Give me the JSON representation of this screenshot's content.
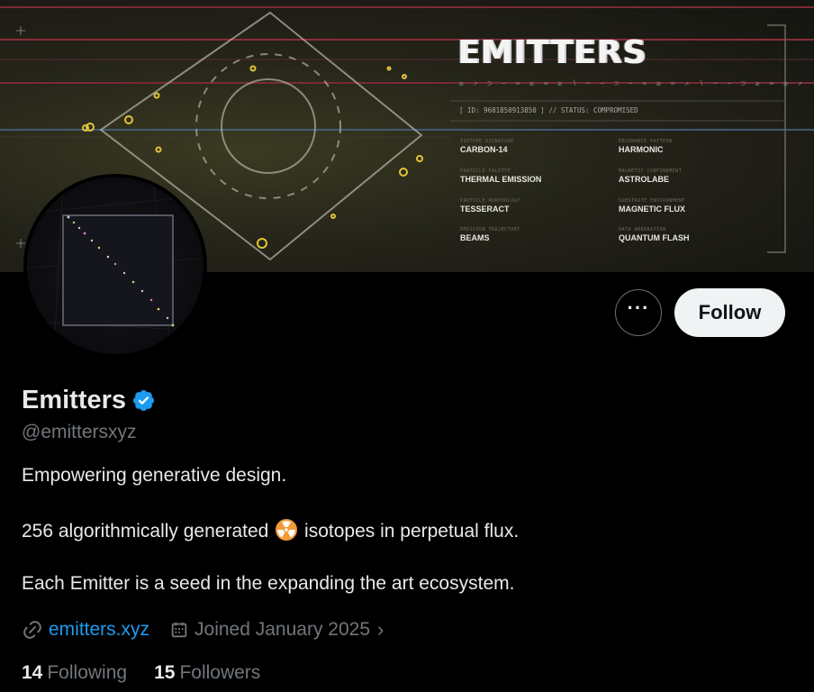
{
  "banner": {
    "title": "EMITTERS",
    "glyphs": "≥ ↗ ⊃ ∽ ≈ ≥ ≈ ≥ ∖ ∽ ~ ⊃ ∽ ≈ ≥ ≈ ↗ ∖ ∽ ~ ⊃ ≥ ≈ ≥ ↗",
    "status": "[ ID: 9601850913850 ]  //  STATUS: COMPROMISED",
    "attributes": [
      {
        "label": "ISOTOPE SIGNATURE",
        "value": "CARBON-14"
      },
      {
        "label": "RESONANCE PATTERN",
        "value": "HARMONIC"
      },
      {
        "label": "PARTICLE PALETTE",
        "value": "THERMAL EMISSION"
      },
      {
        "label": "MAGNETIC CONFINEMENT",
        "value": "ASTROLABE"
      },
      {
        "label": "PARTICLE MORPHOLOGY",
        "value": "TESSERACT"
      },
      {
        "label": "SUBSTRATE ENVIRONMENT",
        "value": "MAGNETIC FLUX"
      },
      {
        "label": "EMISSION TRAJECTORY",
        "value": "BEAMS"
      },
      {
        "label": "DATA ABERRATION",
        "value": "QUANTUM FLASH"
      }
    ]
  },
  "actions": {
    "more_label": "···",
    "follow_label": "Follow"
  },
  "profile": {
    "name": "Emitters",
    "handle": "@emittersxyz",
    "bio_line1": "Empowering generative design.",
    "bio_line2_before": "256 algorithmically generated",
    "bio_line2_after": "isotopes in perpetual flux.",
    "bio_line3": "Each Emitter is a seed in the expanding the art ecosystem.",
    "website": "emitters.xyz",
    "joined": "Joined January 2025",
    "following_count": "14",
    "following_label": "Following",
    "followers_count": "15",
    "followers_label": "Followers"
  },
  "colors": {
    "accent": "#1d9bf0",
    "muted": "#71767b",
    "verified": "#1d9bf0",
    "radioactive": "#f29a38"
  },
  "icons": [
    "verified-badge-icon",
    "link-icon",
    "calendar-icon",
    "chevron-right-icon",
    "more-icon",
    "radioactive-emoji-icon"
  ]
}
